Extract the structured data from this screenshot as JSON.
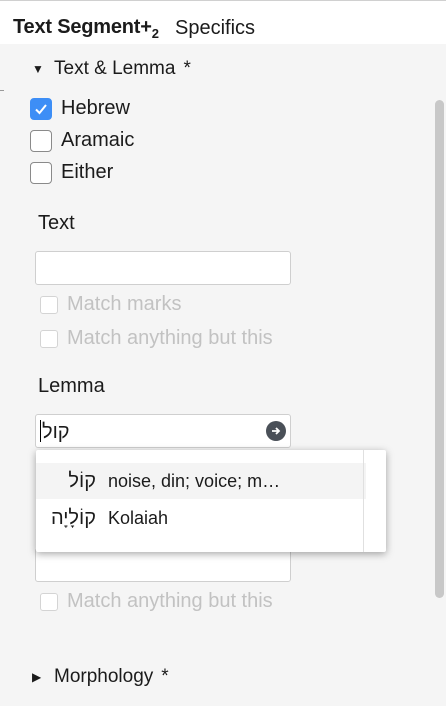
{
  "header": {
    "title": "Text Segment+",
    "title_sub": "2",
    "subtitle": "Specifics"
  },
  "text_lemma_section": {
    "label": "Text & Lemma",
    "required_mark": "*"
  },
  "language_options": [
    {
      "label": "Hebrew",
      "checked": true
    },
    {
      "label": "Aramaic",
      "checked": false
    },
    {
      "label": "Either",
      "checked": false
    }
  ],
  "text_field": {
    "label": "Text",
    "value": "",
    "match_marks": "Match marks",
    "match_anything": "Match anything but this"
  },
  "lemma_field": {
    "label": "Lemma",
    "value": "קול"
  },
  "lemma_suggestions": [
    {
      "hebrew": "קוֹל",
      "gloss": "noise, din; voice; m…"
    },
    {
      "hebrew": "קוֹלָיָה",
      "gloss": "Kolaiah"
    }
  ],
  "lower_match_anything": "Match anything but this",
  "morphology_section": {
    "label": "Morphology",
    "required_mark": "*"
  },
  "colors": {
    "accent": "#3d8ef6",
    "go_button": "#4a5058"
  },
  "icons": {
    "section_expanded": "triangle-down-icon",
    "section_collapsed": "triangle-right-icon",
    "lemma_go": "arrow-right-circle-icon"
  }
}
